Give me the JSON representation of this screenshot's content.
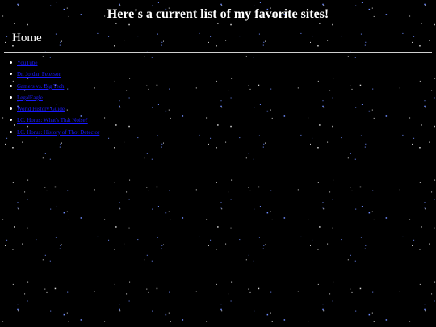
{
  "page": {
    "title": "Here's a current list of my favorite sites!",
    "background_color": "#000000"
  },
  "nav": {
    "home_label": "Home"
  },
  "sites": {
    "link_color": "#1a1aff",
    "items": [
      {
        "label": "YouTube"
      },
      {
        "label": "Dr. Jordan Peterson"
      },
      {
        "label": "Gamers vs. Big Tech"
      },
      {
        "label": "LegalEagle"
      },
      {
        "label": "World History Guide"
      },
      {
        "label": "I.C. Horus: What's That Noise?"
      },
      {
        "label": "I.C. Horus: History of Thot Detector"
      }
    ]
  }
}
